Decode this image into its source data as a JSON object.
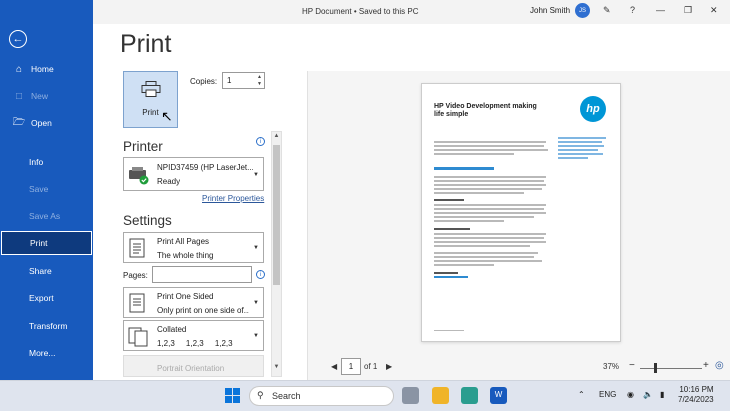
{
  "window": {
    "title": "HP Document • Saved to this PC",
    "user_name": "John Smith",
    "user_initials": "JS"
  },
  "sidebar": {
    "items": [
      {
        "label": "Home",
        "icon": "home-icon",
        "enabled": true
      },
      {
        "label": "New",
        "icon": "new-doc-icon",
        "enabled": false
      },
      {
        "label": "Open",
        "icon": "folder-icon",
        "enabled": true
      },
      {
        "label": "Info",
        "enabled": true
      },
      {
        "label": "Save",
        "enabled": false
      },
      {
        "label": "Save As",
        "enabled": false
      },
      {
        "label": "Print",
        "enabled": true,
        "active": true
      },
      {
        "label": "Share",
        "enabled": true
      },
      {
        "label": "Export",
        "enabled": true
      },
      {
        "label": "Transform",
        "enabled": true
      },
      {
        "label": "More...",
        "enabled": true
      }
    ]
  },
  "print": {
    "heading": "Print",
    "button_label": "Print",
    "copies_label": "Copies:",
    "copies_value": "1",
    "printer_heading": "Printer",
    "printer_name": "NPID37459 (HP LaserJet...",
    "printer_status": "Ready",
    "printer_properties": "Printer Properties",
    "settings_heading": "Settings",
    "range_title": "Print All Pages",
    "range_sub": "The whole thing",
    "pages_label": "Pages:",
    "pages_value": "",
    "sides_title": "Print One Sided",
    "sides_sub": "Only print on one side of...",
    "collate_title": "Collated",
    "collate_sub": "1,2,3     1,2,3     1,2,3",
    "orientation": "Portrait Orientation"
  },
  "preview": {
    "doc_title": "HP Video Development making life simple",
    "logo": "hp",
    "page_current": "1",
    "page_of": "of 1",
    "zoom": "37%"
  },
  "taskbar": {
    "search_placeholder": "Search",
    "language": "ENG",
    "time": "10:16 PM",
    "date": "7/24/2023"
  },
  "colors": {
    "sidebar": "#185abd",
    "accent": "#2b579a",
    "hp_blue": "#0096d6"
  }
}
